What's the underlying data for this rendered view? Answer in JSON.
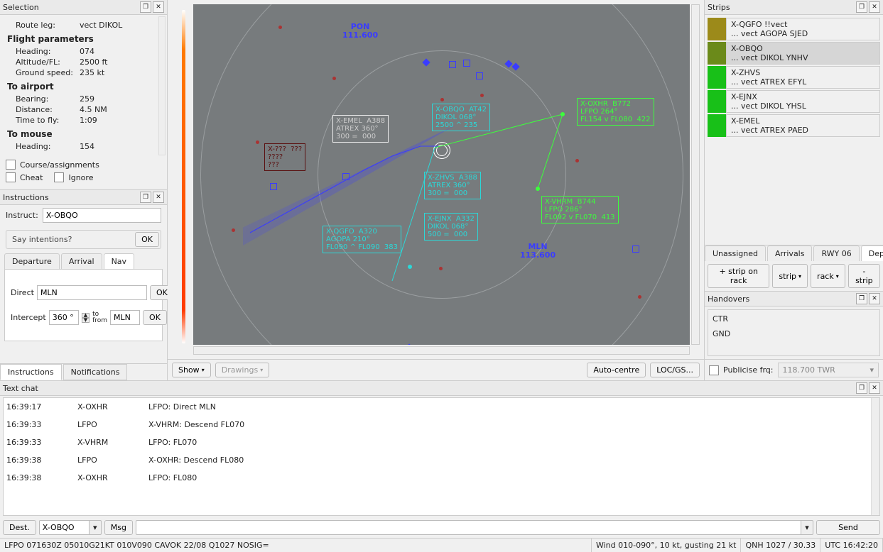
{
  "selection": {
    "title": "Selection",
    "routeLeg": {
      "label": "Route leg:",
      "value": "vect DIKOL"
    },
    "fpTitle": "Flight parameters",
    "heading": {
      "label": "Heading:",
      "value": "074"
    },
    "altitude": {
      "label": "Altitude/FL:",
      "value": "2500 ft"
    },
    "gs": {
      "label": "Ground speed:",
      "value": "235 kt"
    },
    "toApt": "To airport",
    "bearing": {
      "label": "Bearing:",
      "value": "259"
    },
    "distance": {
      "label": "Distance:",
      "value": "4.5 NM"
    },
    "ttf": {
      "label": "Time to fly:",
      "value": "1:09"
    },
    "toMouse": "To mouse",
    "mouseHdg": {
      "label": "Heading:",
      "value": "154"
    },
    "chkCourse": "Course/assignments",
    "chkCheat": "Cheat",
    "chkIgnore": "Ignore"
  },
  "instructions": {
    "title": "Instructions",
    "instructLabel": "Instruct:",
    "instructValue": "X-OBQO",
    "sayIntentions": "Say intentions?",
    "okLabel": "OK",
    "tabs": {
      "dep": "Departure",
      "arr": "Arrival",
      "nav": "Nav"
    },
    "directLabel": "Direct",
    "directValue": "MLN",
    "interceptLabel": "Intercept",
    "interceptDeg": "360 °",
    "toFrom": "to\nfrom",
    "interceptFix": "MLN",
    "bottomTabs": {
      "instr": "Instructions",
      "notif": "Notifications"
    }
  },
  "radar": {
    "pon": {
      "name": "PON",
      "freq": "111.600"
    },
    "mln": {
      "name": "MLN",
      "freq": "113.600"
    },
    "boxes": {
      "obqo": "X-OBQO  AT42\nDIKOL 068°\n2500 ^ 235",
      "zhvs": "X-ZHVS  A388\nATREX 360°\n300 =  000",
      "ejnx": "X-EJNX  A332\nDIKOL 068°\n500 =  000",
      "qgfo": "X-QGFO  A320\nAGOPA 210°\nFL090 ^ FL090  383",
      "emel": "X-EMEL  A388\nATREX 360°\n300 =  000",
      "oxhr": "X-OXHR  B772\nLFPO 264°\nFL154 v FL080  422",
      "vhrm": "X-VHRM  B744\nLFPO 286°\nFL092 v FL070  413",
      "red": "X-???  ???\n????\n???"
    }
  },
  "centerBar": {
    "show": "Show",
    "drawings": "Drawings",
    "autoCentre": "Auto-centre",
    "locGs": "LOC/GS..."
  },
  "strips": {
    "title": "Strips",
    "items": [
      {
        "color": "#9c8a1a",
        "l1": "X-QGFO  !!vect",
        "l2": "... vect AGOPA  SJED"
      },
      {
        "color": "#6b8a1a",
        "l1": "X-OBQO",
        "l2": "... vect DIKOL  YNHV",
        "sel": true
      },
      {
        "color": "#18c018",
        "l1": "X-ZHVS",
        "l2": "... vect ATREX  EFYL"
      },
      {
        "color": "#18c018",
        "l1": "X-EJNX",
        "l2": "... vect DIKOL  YHSL"
      },
      {
        "color": "#18c018",
        "l1": "X-EMEL",
        "l2": "... vect ATREX  PAED"
      }
    ],
    "tabs": {
      "unassigned": "Unassigned",
      "arrivals": "Arrivals",
      "rwy": "RWY 06",
      "dep": "Departures"
    },
    "btns": {
      "add": "+ strip on rack",
      "strip": "strip",
      "rack": "rack",
      "remove": "- strip"
    }
  },
  "handovers": {
    "title": "Handovers",
    "items": [
      "CTR",
      "GND"
    ],
    "publicise": "Publicise frq:",
    "freq": "118.700  TWR"
  },
  "chat": {
    "title": "Text chat",
    "rows": [
      {
        "t": "16:39:17",
        "c": "X-OXHR",
        "m": "LFPO: Direct MLN"
      },
      {
        "t": "16:39:33",
        "c": "LFPO",
        "m": "X-VHRM: Descend FL070"
      },
      {
        "t": "16:39:33",
        "c": "X-VHRM",
        "m": "LFPO: FL070"
      },
      {
        "t": "16:39:38",
        "c": "LFPO",
        "m": "X-OXHR: Descend FL080"
      },
      {
        "t": "16:39:38",
        "c": "X-OXHR",
        "m": "LFPO: FL080"
      }
    ],
    "destBtn": "Dest.",
    "destVal": "X-OBQO",
    "msgBtn": "Msg",
    "sendBtn": "Send"
  },
  "status": {
    "metar": "LFPO 071630Z 05010G21KT 010V090 CAVOK 22/08 Q1027 NOSIG=",
    "wind": "Wind 010-090°, 10 kt, gusting 21 kt",
    "qnh": "QNH 1027 / 30.33",
    "utc": "UTC 16:42:20"
  }
}
